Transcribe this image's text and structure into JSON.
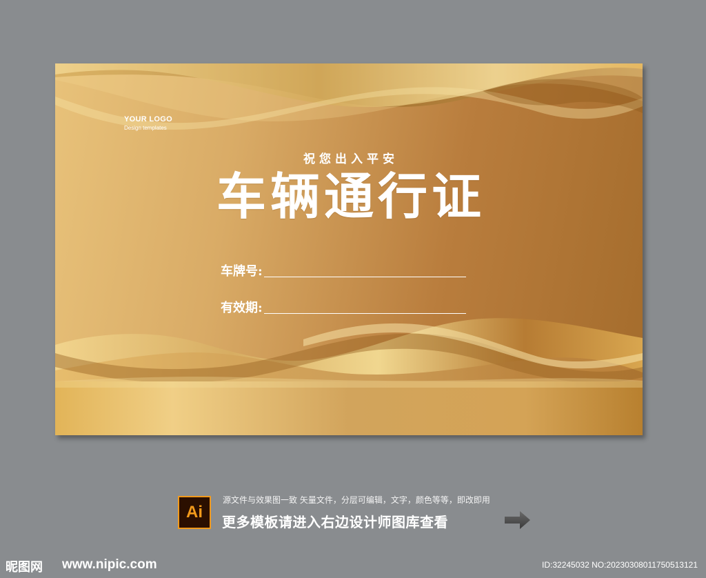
{
  "card": {
    "logo_title": "YOUR LOGO",
    "logo_sub": "Design templates",
    "subtitle": "祝您出入平安",
    "title": "车辆通行证",
    "fields": [
      {
        "label": "车牌号:"
      },
      {
        "label": "有效期:"
      }
    ]
  },
  "info": {
    "badge": "Ai",
    "description": "源文件与效果图一致 矢量文件，分层可编辑，文字，颜色等等，即改即用",
    "cta": "更多模板请进入右边设计师图库查看"
  },
  "footer": {
    "site_name": "昵图网",
    "site_url": "www.nipic.com",
    "id_text": "ID:32245032 NO:20230308011750513121"
  },
  "colors": {
    "background": "#898c8f",
    "gold_light": "#e8c27a",
    "gold_dark": "#a46c2c",
    "badge_orange": "#f29a1b"
  }
}
